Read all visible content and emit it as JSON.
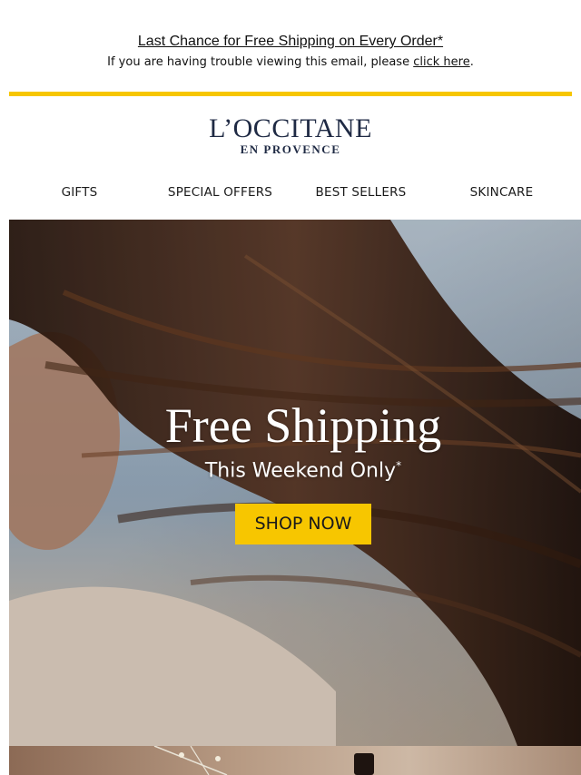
{
  "preheader": {
    "headline": "Last Chance for Free Shipping on Every Order*",
    "trouble_text": "If you are having trouble viewing this email, please ",
    "trouble_link": "click here",
    "trouble_end": "."
  },
  "brand": {
    "logo_main": "L’OCCITANE",
    "logo_sub": "EN PROVENCE",
    "accent_color": "#f7c600",
    "logo_color": "#1f2a44"
  },
  "nav": {
    "items": [
      {
        "label": "GIFTS"
      },
      {
        "label": "SPECIAL OFFERS"
      },
      {
        "label": "BEST SELLERS"
      },
      {
        "label": "SKINCARE"
      }
    ]
  },
  "hero": {
    "title": "Free Shipping",
    "subtitle": "This Weekend Only",
    "subtitle_mark": "*",
    "cta_label": "SHOP NOW",
    "image_subject": "woman-with-windblown-hair"
  }
}
